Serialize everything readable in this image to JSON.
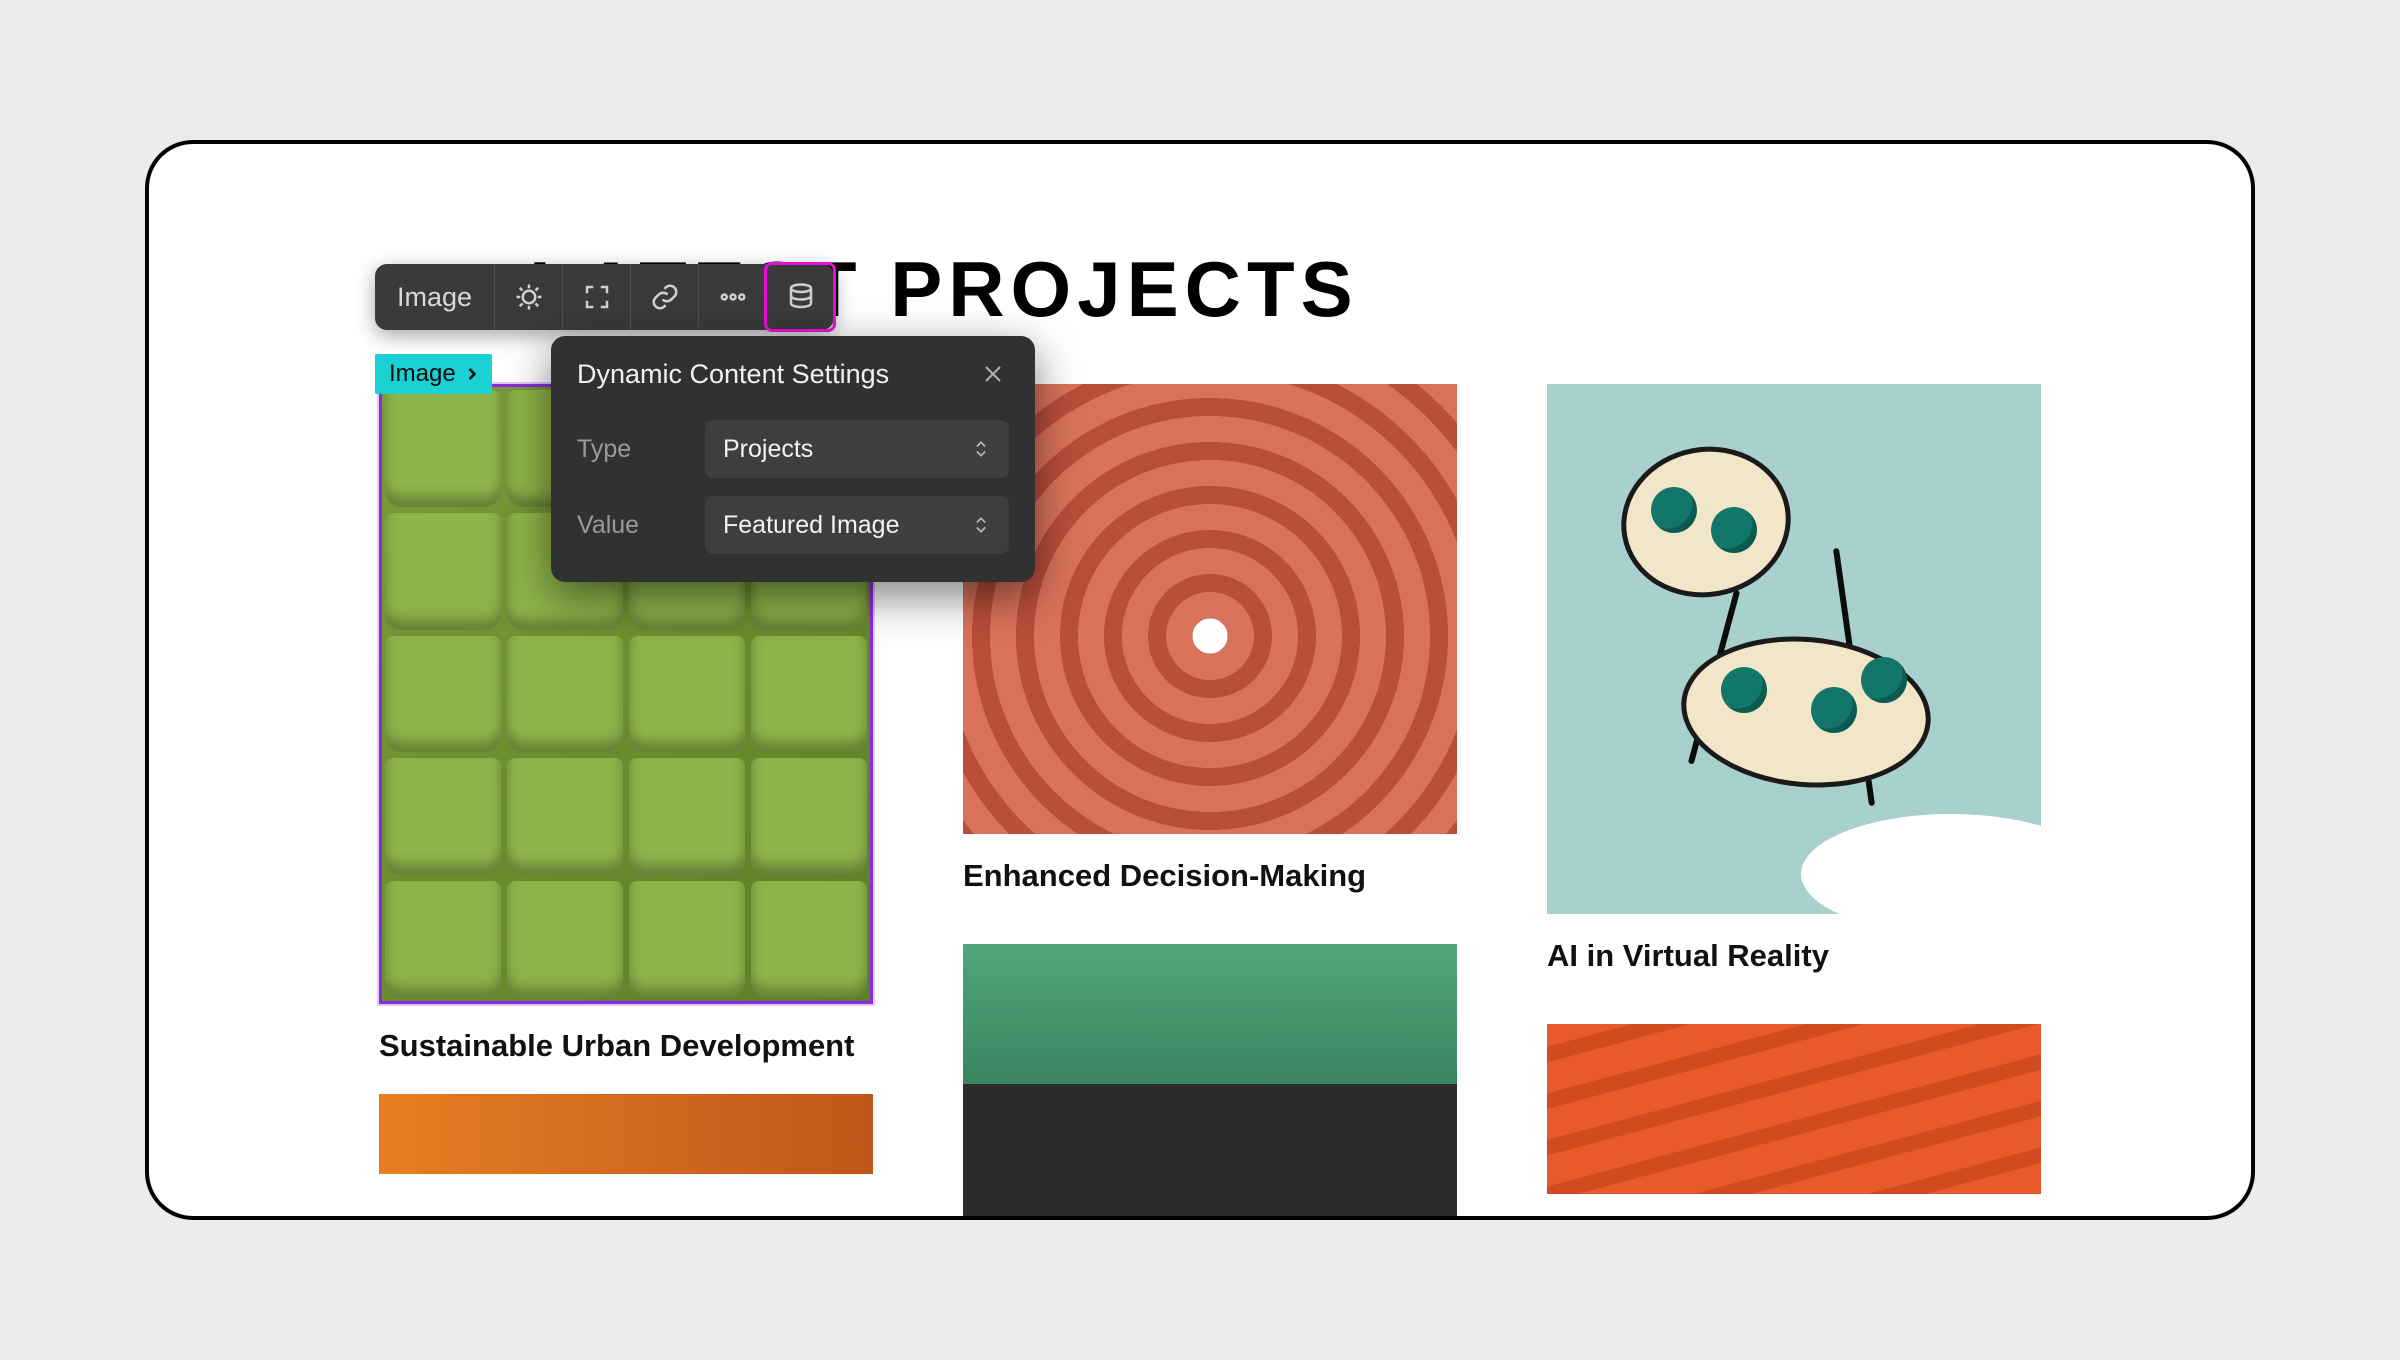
{
  "heading": "LATEST PROJECTS",
  "selection_tag": "Image",
  "toolbar": {
    "label": "Image",
    "icons": [
      {
        "name": "adjust-icon"
      },
      {
        "name": "expand-icon"
      },
      {
        "name": "link-icon"
      },
      {
        "name": "more-icon"
      },
      {
        "name": "database-icon",
        "active": true
      }
    ]
  },
  "popover": {
    "title": "Dynamic Content Settings",
    "rows": [
      {
        "label": "Type",
        "value": "Projects"
      },
      {
        "label": "Value",
        "value": "Featured Image"
      }
    ]
  },
  "projects": [
    {
      "title": "Sustainable Urban Development"
    },
    {
      "title": "Enhanced Decision-Making"
    },
    {
      "title": "AI in Virtual Reality"
    },
    {
      "title": ""
    },
    {
      "title": ""
    },
    {
      "title": ""
    }
  ]
}
